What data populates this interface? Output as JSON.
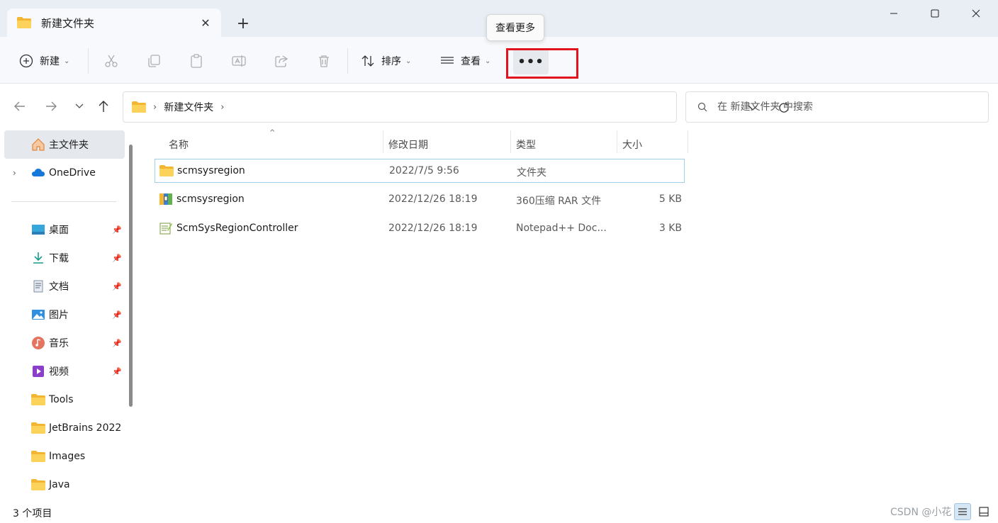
{
  "window": {
    "tab_title": "新建文件夹",
    "tab_close": "✕",
    "new_tab": "+"
  },
  "toolbar": {
    "new_label": "新建",
    "sort_label": "排序",
    "view_label": "查看",
    "more_label": "•••",
    "tooltip": "查看更多",
    "caret": "⌄"
  },
  "navigation": {
    "breadcrumb_separator": "›",
    "breadcrumb": [
      "新建文件夹"
    ],
    "search_placeholder": "在 新建文件夹 中搜索"
  },
  "sidebar": {
    "items": [
      {
        "label": "主文件夹",
        "icon": "home-icon",
        "active": true
      },
      {
        "label": "OneDrive",
        "icon": "onedrive-icon",
        "expandable": true
      },
      {
        "label": "桌面",
        "icon": "desktop-icon",
        "pinned": true
      },
      {
        "label": "下载",
        "icon": "download-icon",
        "pinned": true
      },
      {
        "label": "文档",
        "icon": "document-icon",
        "pinned": true
      },
      {
        "label": "图片",
        "icon": "pictures-icon",
        "pinned": true
      },
      {
        "label": "音乐",
        "icon": "music-icon",
        "pinned": true
      },
      {
        "label": "视频",
        "icon": "video-icon",
        "pinned": true
      },
      {
        "label": "Tools",
        "icon": "folder-icon"
      },
      {
        "label": "JetBrains 2022",
        "icon": "folder-icon"
      },
      {
        "label": "Images",
        "icon": "folder-icon"
      },
      {
        "label": "Java",
        "icon": "folder-icon"
      }
    ]
  },
  "file_list": {
    "columns": {
      "name": "名称",
      "date": "修改日期",
      "type": "类型",
      "size": "大小"
    },
    "sort_indicator": "^",
    "rows": [
      {
        "name": "scmsysregion",
        "date": "2022/7/5 9:56",
        "type": "文件夹",
        "size": "",
        "icon": "folder-icon"
      },
      {
        "name": "scmsysregion",
        "date": "2022/12/26 18:19",
        "type": "360压缩 RAR 文件",
        "size": "5 KB",
        "icon": "rar-archive-icon"
      },
      {
        "name": "ScmSysRegionController",
        "date": "2022/12/26 18:19",
        "type": "Notepad++ Doc...",
        "size": "3 KB",
        "icon": "notepadpp-file-icon"
      }
    ]
  },
  "status": {
    "item_count": "3 个项目",
    "watermark": "CSDN @小花"
  },
  "colors": {
    "highlight_box": "#e0131f",
    "selection_border": "#9fcfe6",
    "titlebar_bg": "#e9eef5",
    "toolbar_bg": "#f7f9fc",
    "folder_yellow": "#f7c542"
  }
}
